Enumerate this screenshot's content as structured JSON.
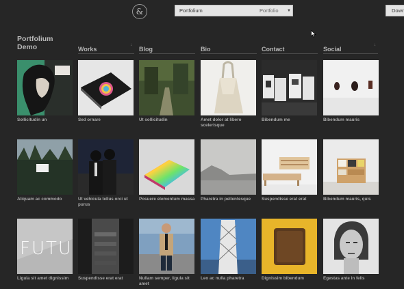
{
  "header": {
    "logo_glyph": "&",
    "theme_select": {
      "value": "Portfolium",
      "name": "Portfolio"
    },
    "download_label": "Down"
  },
  "site_title": "Portfolium Demo",
  "nav": [
    {
      "label": "Works"
    },
    {
      "label": "Blog"
    },
    {
      "label": "Bio"
    },
    {
      "label": "Contact"
    },
    {
      "label": "Social"
    }
  ],
  "items": [
    {
      "caption": "Sollicitudin un"
    },
    {
      "caption": "Sed ornare"
    },
    {
      "caption": "Ut sollicitudin"
    },
    {
      "caption": "Amet dolor at libero scelerisque"
    },
    {
      "caption": "Bibendum me"
    },
    {
      "caption": "Bibendum mauris"
    },
    {
      "caption": "Aliquam ac commodo"
    },
    {
      "caption": "Ut vehicula tellus orci ut purus"
    },
    {
      "caption": "Posuere elementum massa"
    },
    {
      "caption": "Pharetra in pellentesque"
    },
    {
      "caption": "Suspendisse erat erat"
    },
    {
      "caption": "Bibendum mauris, quis"
    },
    {
      "caption": "Ligula sit amet dignissim"
    },
    {
      "caption": "Suspendisse erat erat"
    },
    {
      "caption": "Nullam semper, ligula sit amet"
    },
    {
      "caption": "Leo ac nulla pharetra"
    },
    {
      "caption": "Dignissim bibendum"
    },
    {
      "caption": "Egestas ante in felis"
    }
  ],
  "tile_text": {
    "futu": "FUTU"
  }
}
